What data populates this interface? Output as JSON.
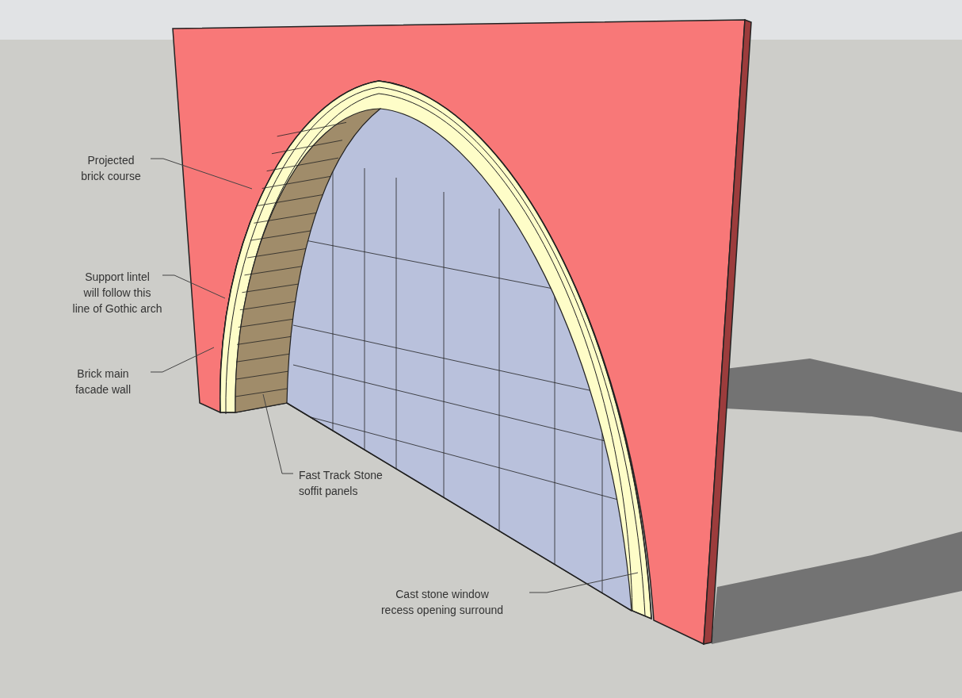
{
  "annotations": [
    {
      "lines": [
        "Projected",
        "brick course"
      ]
    },
    {
      "lines": [
        "Support lintel",
        "will follow this",
        "line of Gothic arch"
      ]
    },
    {
      "lines": [
        "Brick main",
        "facade wall"
      ]
    },
    {
      "lines": [
        "Fast Track Stone",
        "soffit panels"
      ]
    },
    {
      "lines": [
        "Cast stone window",
        "recess opening surround"
      ]
    }
  ]
}
